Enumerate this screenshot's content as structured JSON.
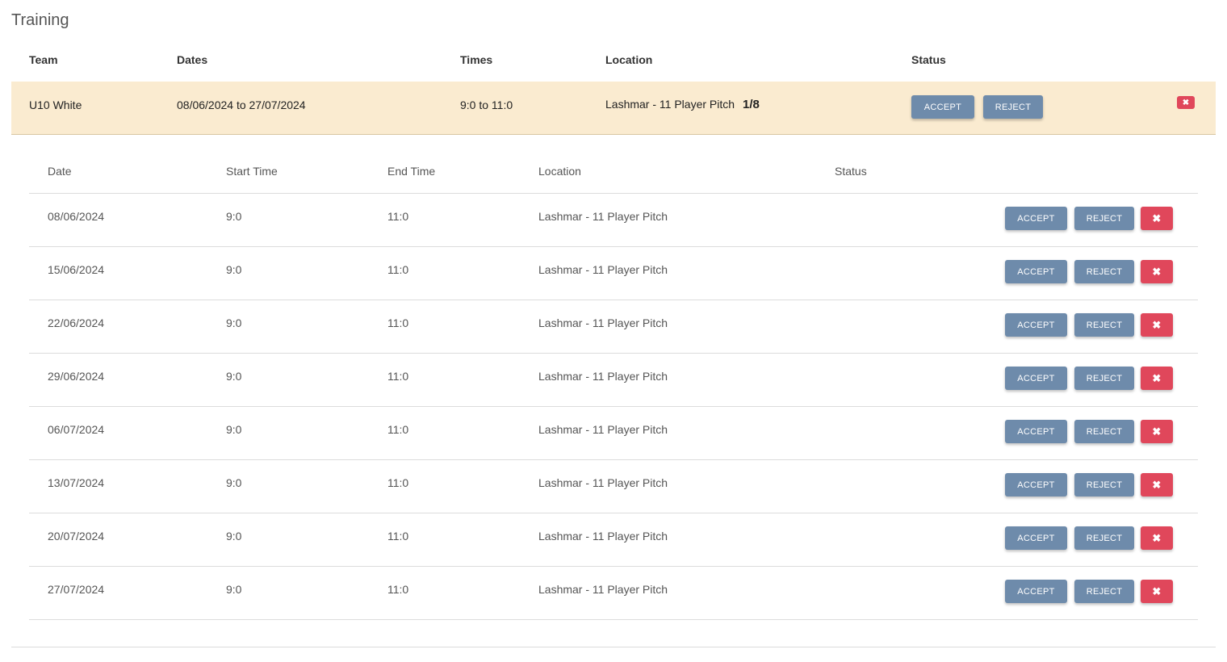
{
  "page_title": "Training",
  "summary": {
    "headers": {
      "team": "Team",
      "dates": "Dates",
      "times": "Times",
      "location": "Location",
      "status": "Status"
    },
    "row": {
      "team": "U10 White",
      "dates": "08/06/2024 to 27/07/2024",
      "times": "9:0 to 11:0",
      "location": "Lashmar - 11 Player Pitch",
      "count": "1/8",
      "accept_label": "ACCEPT",
      "reject_label": "REJECT",
      "delete_icon": "close-icon"
    },
    "row_color": "#faebd0"
  },
  "detail": {
    "headers": {
      "date": "Date",
      "start": "Start Time",
      "end": "End Time",
      "location": "Location",
      "status": "Status"
    },
    "rows": [
      {
        "date": "08/06/2024",
        "start": "9:0",
        "end": "11:0",
        "location": "Lashmar - 11 Player Pitch",
        "accept": "ACCEPT",
        "reject": "REJECT",
        "delete": "✖"
      },
      {
        "date": "15/06/2024",
        "start": "9:0",
        "end": "11:0",
        "location": "Lashmar - 11 Player Pitch",
        "accept": "ACCEPT",
        "reject": "REJECT",
        "delete": "✖"
      },
      {
        "date": "22/06/2024",
        "start": "9:0",
        "end": "11:0",
        "location": "Lashmar - 11 Player Pitch",
        "accept": "ACCEPT",
        "reject": "REJECT",
        "delete": "✖"
      },
      {
        "date": "29/06/2024",
        "start": "9:0",
        "end": "11:0",
        "location": "Lashmar - 11 Player Pitch",
        "accept": "ACCEPT",
        "reject": "REJECT",
        "delete": "✖"
      },
      {
        "date": "06/07/2024",
        "start": "9:0",
        "end": "11:0",
        "location": "Lashmar - 11 Player Pitch",
        "accept": "ACCEPT",
        "reject": "REJECT",
        "delete": "✖"
      },
      {
        "date": "13/07/2024",
        "start": "9:0",
        "end": "11:0",
        "location": "Lashmar - 11 Player Pitch",
        "accept": "ACCEPT",
        "reject": "REJECT",
        "delete": "✖"
      },
      {
        "date": "20/07/2024",
        "start": "9:0",
        "end": "11:0",
        "location": "Lashmar - 11 Player Pitch",
        "accept": "ACCEPT",
        "reject": "REJECT",
        "delete": "✖"
      },
      {
        "date": "27/07/2024",
        "start": "9:0",
        "end": "11:0",
        "location": "Lashmar - 11 Player Pitch",
        "accept": "ACCEPT",
        "reject": "REJECT",
        "delete": "✖"
      }
    ]
  },
  "colors": {
    "accept_button": "#6e8bab",
    "reject_button": "#6e8bab",
    "delete_button": "#e0475b"
  }
}
